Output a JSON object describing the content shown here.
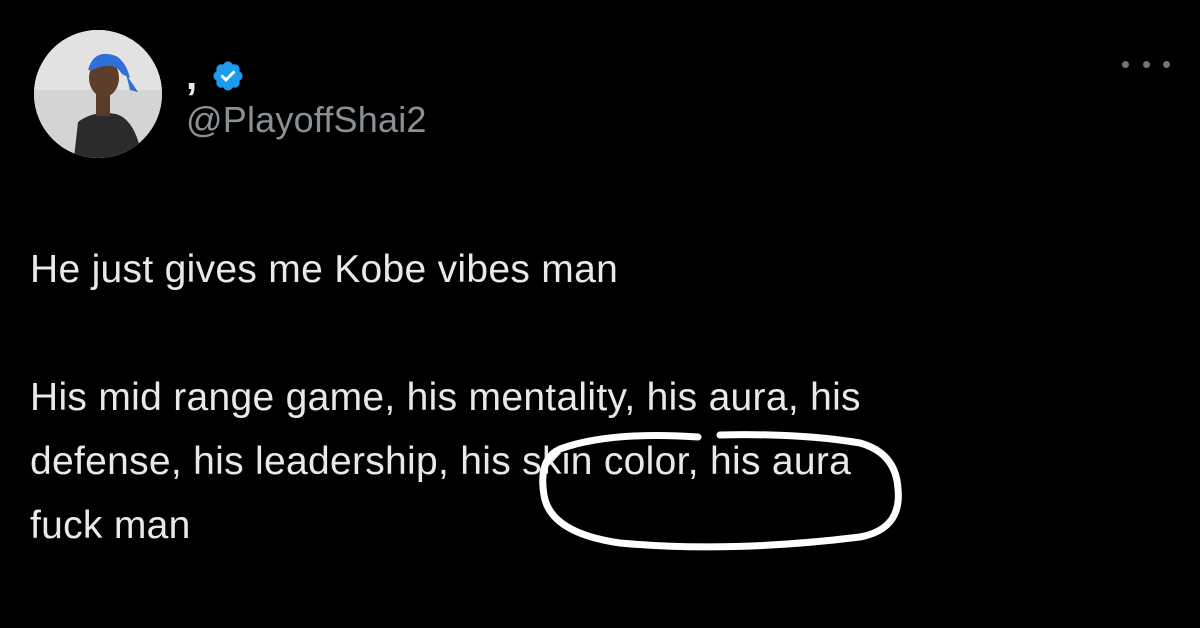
{
  "author": {
    "display_name": ",",
    "handle": "@PlayoffShai2",
    "verified": true,
    "verified_color": "#1d9bf0",
    "avatar_icon": "profile-photo"
  },
  "menu": {
    "icon": "more-horizontal-icon"
  },
  "tweet": {
    "line1": "He just gives me Kobe vibes man",
    "line2": "His mid range game, his mentality, his aura, his",
    "line3": "defense, his leadership, his skin color, his aura",
    "line4": "fuck man"
  },
  "annotation": {
    "type": "hand-drawn circle",
    "color": "#ffffff",
    "highlights": "his skin color"
  },
  "colors": {
    "background": "#000000",
    "text": "#e7e9ea",
    "secondary": "#8b9095"
  }
}
